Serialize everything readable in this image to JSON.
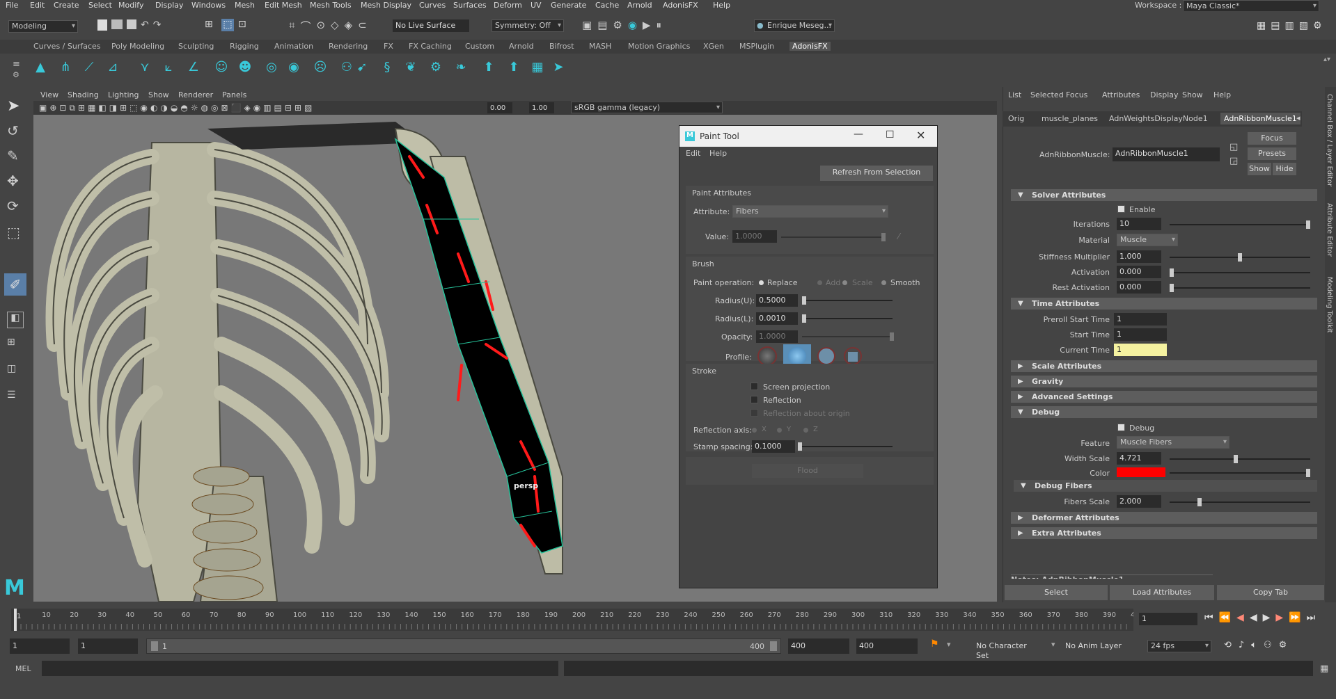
{
  "menu": [
    "File",
    "Edit",
    "Create",
    "Select",
    "Modify",
    "Display",
    "Windows",
    "Mesh",
    "Edit Mesh",
    "Mesh Tools",
    "Mesh Display",
    "Curves",
    "Surfaces",
    "Deform",
    "UV",
    "Generate",
    "Cache",
    "Arnold",
    "AdonisFX",
    "Help"
  ],
  "workspace": {
    "label": "Workspace :",
    "value": "Maya Classic*"
  },
  "status": {
    "mode": "Modeling",
    "live_surface": "No Live Surface",
    "symmetry": "Symmetry: Off",
    "user": "Enrique Meseg..."
  },
  "shelf_tabs": [
    "Curves / Surfaces",
    "Poly Modeling",
    "Sculpting",
    "Rigging",
    "Animation",
    "Rendering",
    "FX",
    "FX Caching",
    "Custom",
    "Arnold",
    "Bifrost",
    "MASH",
    "Motion Graphics",
    "XGen",
    "MSPlugin",
    "AdonisFX"
  ],
  "viewport": {
    "menu": [
      "View",
      "Shading",
      "Lighting",
      "Show",
      "Renderer",
      "Panels"
    ],
    "near": "0.00",
    "far": "1.00",
    "colorspace": "sRGB gamma (legacy)",
    "camera": "persp"
  },
  "paint_tool": {
    "title": "Paint Tool",
    "menu": [
      "Edit",
      "Help"
    ],
    "refresh": "Refresh From Selection",
    "attrs_header": "Paint Attributes",
    "attribute_label": "Attribute:",
    "attribute_value": "Fibers",
    "value_label": "Value:",
    "value": "1.0000",
    "brush_header": "Brush",
    "paint_op_label": "Paint operation:",
    "ops": [
      "Replace",
      "Add",
      "Scale",
      "Smooth"
    ],
    "radius_u_label": "Radius(U):",
    "radius_u": "0.5000",
    "radius_l_label": "Radius(L):",
    "radius_l": "0.0010",
    "opacity_label": "Opacity:",
    "opacity": "1.0000",
    "profile_label": "Profile:",
    "stroke_header": "Stroke",
    "screen_proj": "Screen projection",
    "reflection": "Reflection",
    "reflection_origin": "Reflection about origin",
    "refl_axis_label": "Reflection axis:",
    "axes": [
      "X",
      "Y",
      "Z"
    ],
    "stamp_label": "Stamp spacing:",
    "stamp": "0.1000",
    "flood": "Flood"
  },
  "attr_editor": {
    "menu": [
      "List",
      "Selected",
      "Focus",
      "Attributes",
      "Display",
      "Show",
      "Help"
    ],
    "tabs": [
      "Orig",
      "muscle_planes",
      "AdnWeightsDisplayNode1",
      "AdnRibbonMuscle1"
    ],
    "node_label": "AdnRibbonMuscle:",
    "node_value": "AdnRibbonMuscle1",
    "focus": "Focus",
    "presets": "Presets",
    "show": "Show",
    "hide": "Hide",
    "solver": "Solver Attributes",
    "enable": "Enable",
    "iterations_label": "Iterations",
    "iterations": "10",
    "material_label": "Material",
    "material": "Muscle",
    "stiffness_label": "Stiffness Multiplier",
    "stiffness": "1.000",
    "activation_label": "Activation",
    "activation": "0.000",
    "rest_label": "Rest Activation",
    "rest": "0.000",
    "time": "Time Attributes",
    "preroll_label": "Preroll Start Time",
    "preroll": "1",
    "start_label": "Start Time",
    "start": "1",
    "current_label": "Current Time",
    "current": "1",
    "scale": "Scale Attributes",
    "gravity": "Gravity",
    "advanced": "Advanced Settings",
    "debug": "Debug",
    "debug_chk": "Debug",
    "feature_label": "Feature",
    "feature": "Muscle Fibers",
    "width_label": "Width Scale",
    "width": "4.721",
    "color_label": "Color",
    "debug_fibers": "Debug Fibers",
    "fibers_scale_label": "Fibers Scale",
    "fibers_scale": "2.000",
    "deformer": "Deformer Attributes",
    "extra": "Extra Attributes",
    "notes": "Notes: AdnRibbonMuscle1",
    "select": "Select",
    "load": "Load Attributes",
    "copy": "Copy Tab"
  },
  "side_tabs": [
    "Channel Box / Layer Editor",
    "Attribute Editor",
    "Modeling Toolkit"
  ],
  "timeline": {
    "ticks": [
      "10",
      "20",
      "30",
      "40",
      "50",
      "60",
      "70",
      "80",
      "90",
      "100",
      "110",
      "120",
      "130",
      "140",
      "150",
      "160",
      "170",
      "180",
      "190",
      "200",
      "210",
      "220",
      "230",
      "240",
      "250",
      "260",
      "270",
      "280",
      "290",
      "300",
      "310",
      "320",
      "330",
      "340",
      "350",
      "360",
      "370",
      "380",
      "390",
      "400"
    ],
    "start_tick": "1",
    "current": "1"
  },
  "range": {
    "start": "1",
    "inner_start": "1",
    "slider_start": "1",
    "slider_end": "400",
    "end_inner": "400",
    "end": "400",
    "char_set": "No Character Set",
    "anim_layer": "No Anim Layer",
    "fps": "24 fps"
  },
  "cmd": {
    "label": "MEL"
  },
  "colors": {
    "debug_color": "#ff0000",
    "current_time_bg": "#f5f2a0",
    "accent": "#39c9d9"
  }
}
